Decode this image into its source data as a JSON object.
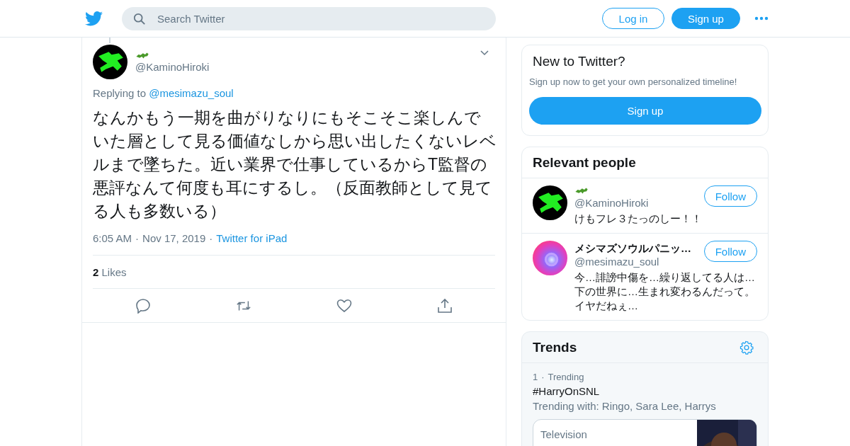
{
  "header": {
    "search": {
      "placeholder": "Search Twitter"
    },
    "login": "Log in",
    "signup": "Sign up"
  },
  "tweet": {
    "handle": "@KaminoHiroki",
    "replying_label": "Replying to",
    "replying_to": "@mesimazu_soul",
    "separator": "·",
    "text": "なんかもう一期を曲がりなりにもそこそこ楽しんでいた層として見る価値なしから思い出したくないレベルまで墜ちた。近い業界で仕事しているからT監督の悪評なんて何度も耳にするし。（反面教師として見てる人も多数いる）",
    "time": "6:05 AM",
    "date": "Nov 17, 2019",
    "source": "Twitter for iPad",
    "likes_count": "2",
    "likes_label": "Likes"
  },
  "new_to_twitter": {
    "title": "New to Twitter?",
    "subtitle": "Sign up now to get your own personalized timeline!",
    "button": "Sign up"
  },
  "relevant_people": {
    "title": "Relevant people",
    "people": [
      {
        "handle": "@KaminoHiroki",
        "bio": "けもフレ３たっのしー！！",
        "follow": "Follow"
      },
      {
        "name": "メシマズソウルパニッ…",
        "handle": "@mesimazu_soul",
        "bio": "今…誹謗中傷を…繰り返してる人は…下の世界に…生まれ変わるんだって。イヤだねぇ…",
        "follow": "Follow"
      }
    ]
  },
  "trends": {
    "title": "Trends",
    "items": [
      {
        "rank": "1",
        "separator": "·",
        "meta": "Trending",
        "tag": "#HarryOnSNL",
        "with": "Trending with: Ringo, Sara Lee, Harrys",
        "card": {
          "category": "Television",
          "kind": "picture"
        }
      }
    ]
  }
}
